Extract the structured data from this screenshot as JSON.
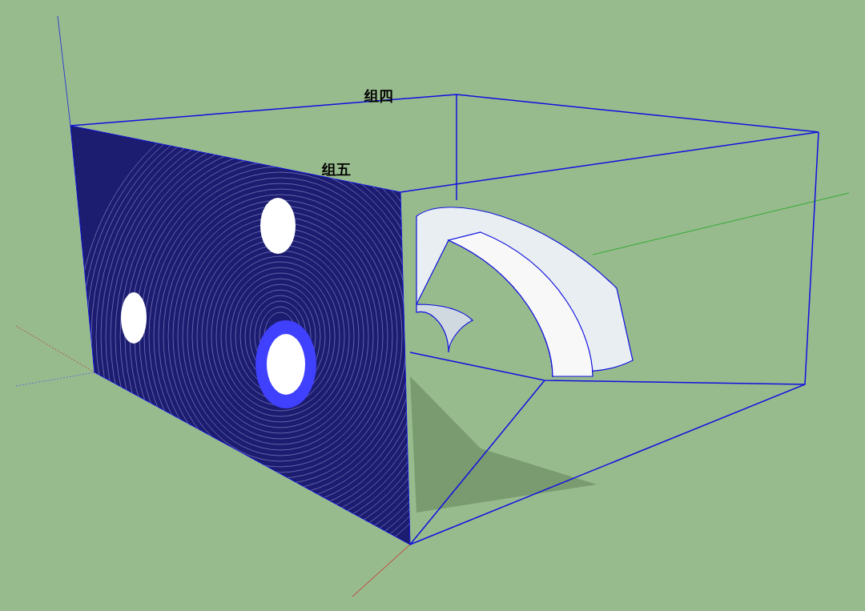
{
  "viewport": {
    "labels": [
      {
        "text": "组四"
      },
      {
        "text": "组五"
      }
    ]
  }
}
